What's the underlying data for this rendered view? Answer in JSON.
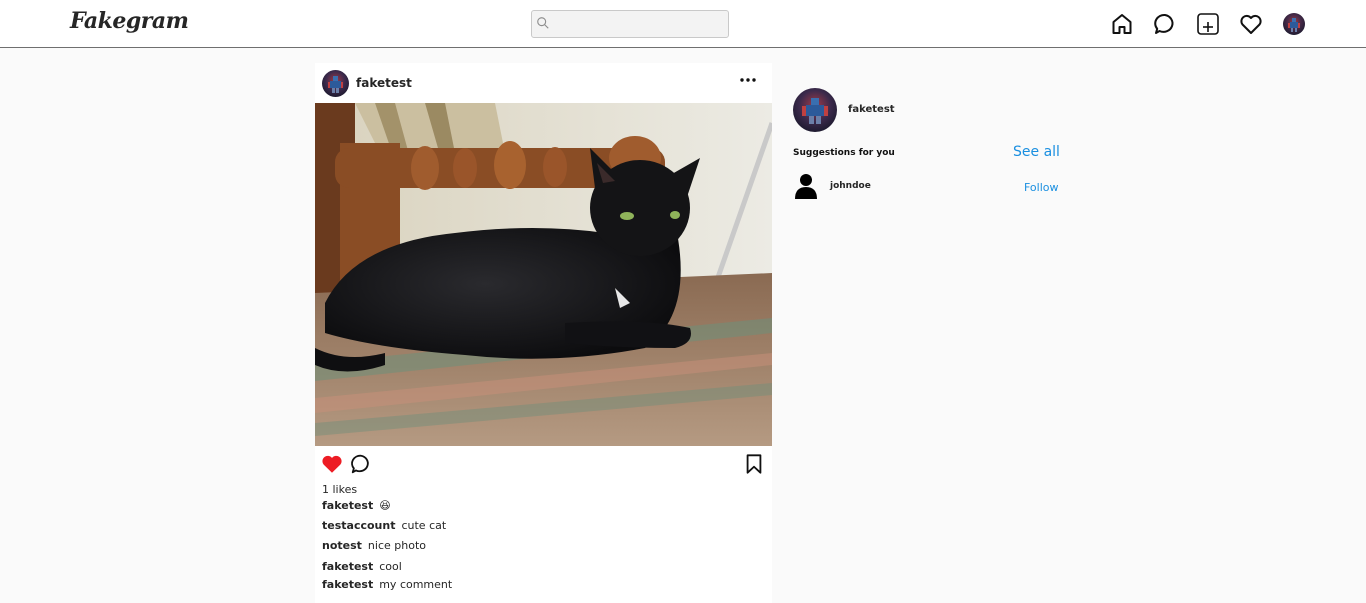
{
  "app": {
    "logo": "Fakegram"
  },
  "search": {
    "placeholder": "",
    "value": ""
  },
  "nav": {
    "icons": [
      "home-icon",
      "messages-icon",
      "new-post-icon",
      "activity-icon",
      "profile-avatar"
    ]
  },
  "post": {
    "username": "faketest",
    "liked": true,
    "likes_text": "1 likes",
    "caption": {
      "user": "faketest",
      "text": "😆"
    },
    "comments": [
      {
        "user": "testaccount",
        "text": "cute cat"
      },
      {
        "user": "notest",
        "text": "nice photo"
      },
      {
        "user": "faketest",
        "text": "cool"
      },
      {
        "user": "faketest",
        "text": "my comment"
      }
    ]
  },
  "sidebar": {
    "current_user": "faketest",
    "suggestions_title": "Suggestions for you",
    "see_all_label": "See all",
    "suggestions": [
      {
        "username": "johndoe",
        "follow_label": "Follow"
      }
    ]
  },
  "colors": {
    "like_red": "#ed1c24",
    "link_blue": "#1a8fe0"
  }
}
